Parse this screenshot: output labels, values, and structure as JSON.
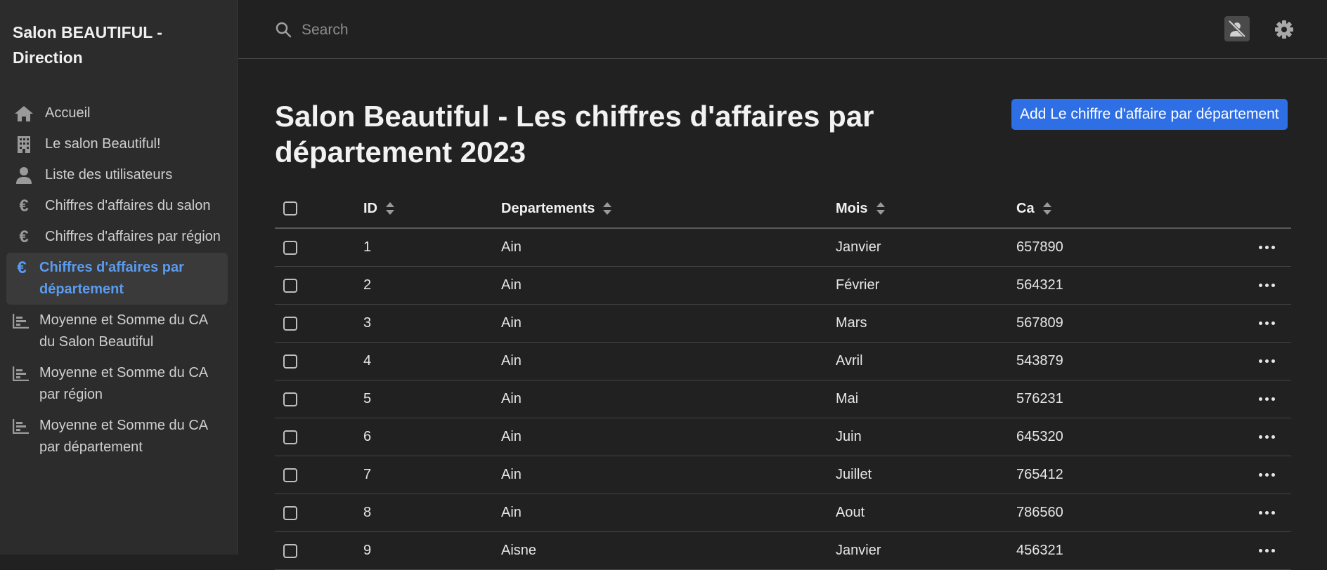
{
  "sidebar": {
    "brand": "Salon BEAUTIFUL - Direction",
    "items": [
      {
        "label": "Accueil",
        "icon": "home-icon"
      },
      {
        "label": "Le salon Beautiful!",
        "icon": "building-icon"
      },
      {
        "label": "Liste des utilisateurs",
        "icon": "user-icon"
      },
      {
        "label": "Chiffres d'affaires du salon",
        "icon": "euro-icon"
      },
      {
        "label": "Chiffres d'affaires par région",
        "icon": "euro-icon"
      },
      {
        "label": "Chiffres d'affaires par département",
        "icon": "euro-icon",
        "active": true
      },
      {
        "label": "Moyenne et Somme du CA du Salon Beautiful",
        "icon": "bar-chart-icon"
      },
      {
        "label": "Moyenne et Somme du CA par région",
        "icon": "bar-chart-icon"
      },
      {
        "label": "Moyenne et Somme du CA par département",
        "icon": "bar-chart-icon"
      }
    ]
  },
  "topbar": {
    "search_placeholder": "Search",
    "search_value": ""
  },
  "main": {
    "title": "Salon Beautiful - Les chiffres d'affaires par département 2023",
    "add_button": "Add Le chiffre d'affaire par département"
  },
  "table": {
    "columns": [
      "ID",
      "Departements",
      "Mois",
      "Ca"
    ],
    "rows": [
      [
        "1",
        "Ain",
        "Janvier",
        "657890"
      ],
      [
        "2",
        "Ain",
        "Février",
        "564321"
      ],
      [
        "3",
        "Ain",
        "Mars",
        "567809"
      ],
      [
        "4",
        "Ain",
        "Avril",
        "543879"
      ],
      [
        "5",
        "Ain",
        "Mai",
        "576231"
      ],
      [
        "6",
        "Ain",
        "Juin",
        "645320"
      ],
      [
        "7",
        "Ain",
        "Juillet",
        "765412"
      ],
      [
        "8",
        "Ain",
        "Aout",
        "786560"
      ],
      [
        "9",
        "Aisne",
        "Janvier",
        "456321"
      ]
    ]
  },
  "colors": {
    "accent": "#2f6fe6",
    "active_nav": "#5a9bf0",
    "background": "#212121",
    "sidebar": "#2c2c2c"
  }
}
